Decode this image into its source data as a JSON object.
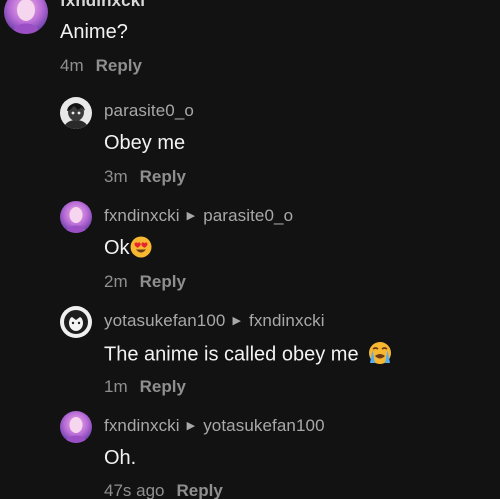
{
  "top_comment": {
    "username": "fxndinxcki",
    "text": "Anime?",
    "time": "4m",
    "reply_label": "Reply"
  },
  "replies": [
    {
      "username": "parasite0_o",
      "reply_to": "",
      "text": "Obey me",
      "time": "3m",
      "reply_label": "Reply",
      "avatar_icon": "dark-anime-avatar"
    },
    {
      "username": "fxndinxcki",
      "reply_to": "parasite0_o",
      "text": "Ok",
      "emoji": "heart-eyes-emoji",
      "time": "2m",
      "reply_label": "Reply",
      "avatar_icon": "pink-purple-avatar"
    },
    {
      "username": "yotasukefan100",
      "reply_to": "fxndinxcki",
      "text": "The anime is called obey me",
      "emoji": "loudly-crying-emoji",
      "time": "1m",
      "reply_label": "Reply",
      "avatar_icon": "monochrome-anime-avatar"
    },
    {
      "username": "fxndinxcki",
      "reply_to": "yotasukefan100",
      "text": "Oh.",
      "time": "47s ago",
      "reply_label": "Reply",
      "avatar_icon": "pink-purple-avatar"
    }
  ],
  "colors": {
    "background": "#121212",
    "primary_text": "#f2f2f2",
    "secondary_text": "#a8a8a8",
    "meta_text": "#8f8f8f"
  }
}
